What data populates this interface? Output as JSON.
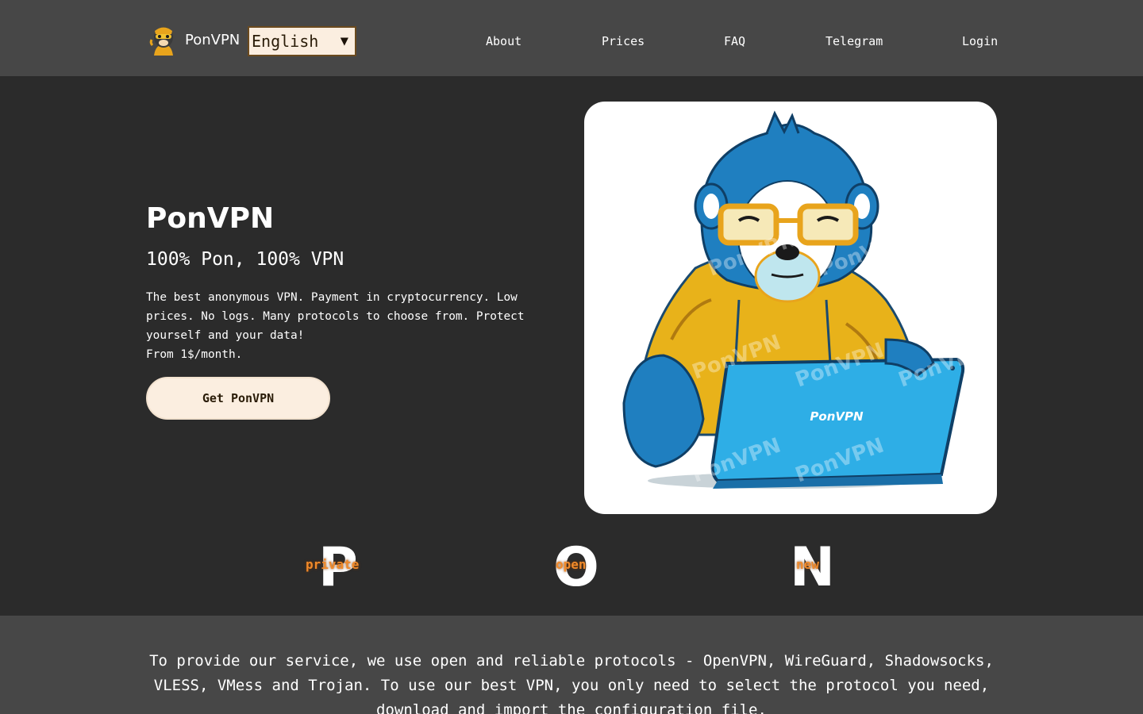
{
  "header": {
    "brand": "PonVPN",
    "language": {
      "selected": "English",
      "arrow": "▼"
    },
    "nav": [
      {
        "label": "About"
      },
      {
        "label": "Prices"
      },
      {
        "label": "FAQ"
      },
      {
        "label": "Telegram"
      },
      {
        "label": "Login"
      }
    ]
  },
  "hero": {
    "title": "PonVPN",
    "subtitle": "100% Pon, 100% VPN",
    "description": [
      "The best anonymous VPN. Payment in cryptocurrency. Low prices. No logs. Many protocols to choose from. Protect yourself and your data!",
      "From 1$/month."
    ],
    "cta_label": "Get PonVPN",
    "illustration": {
      "laptop_label": "PonVPN",
      "watermark": "PonVPN"
    }
  },
  "pon": [
    {
      "letter": "P",
      "word": "private"
    },
    {
      "letter": "O",
      "word": "open"
    },
    {
      "letter": "N",
      "word": "new"
    }
  ],
  "protocols_text": "To provide our service, we use open and reliable protocols - OpenVPN, WireGuard, Shadowsocks, VLESS, VMess and Trojan. To use our best VPN, you only need to select the protocol you need, download and import the configuration file.",
  "colors": {
    "header_bg": "#474747",
    "page_bg": "#2b2b2b",
    "accent_cream": "#fbeee0",
    "accent_orange": "#f08a2a",
    "monkey_blue": "#1f7fc0",
    "hoodie_yellow": "#e8b21a",
    "laptop_blue": "#2eaee6"
  }
}
